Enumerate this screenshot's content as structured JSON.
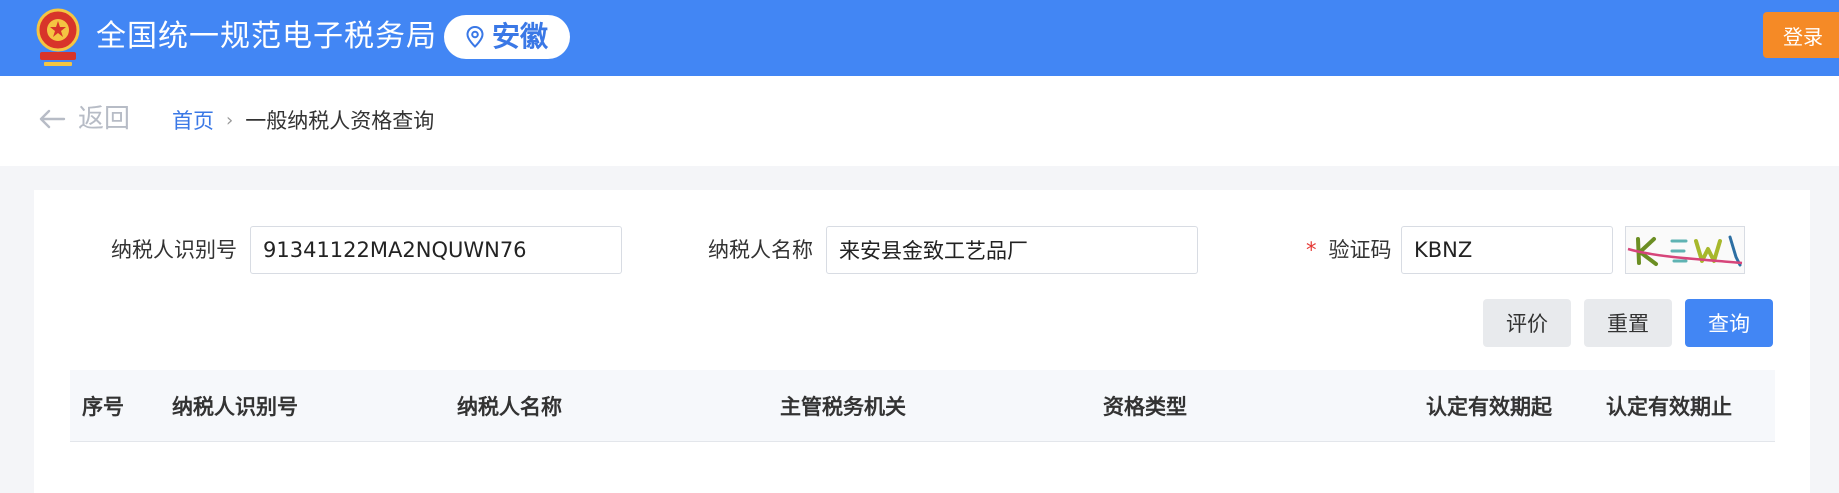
{
  "header": {
    "site_title": "全国统一规范电子税务局",
    "region": "安徽",
    "login_label": "登录",
    "colors": {
      "header_bg": "#4286f4",
      "login_bg": "#f58a26"
    }
  },
  "breadcrumb": {
    "back_label": "返回",
    "home_label": "首页",
    "separator": "›",
    "current_label": "一般纳税人资格查询"
  },
  "form": {
    "taxpayer_id": {
      "label": "纳税人识别号",
      "value": "91341122MA2NQUWN76"
    },
    "taxpayer_name": {
      "label": "纳税人名称",
      "value": "来安县金致工艺品厂"
    },
    "captcha": {
      "required_mark": "*",
      "label": "验证码",
      "value": "KBNZ"
    }
  },
  "actions": {
    "evaluate_label": "评价",
    "reset_label": "重置",
    "query_label": "查询"
  },
  "table": {
    "columns": [
      "序号",
      "纳税人识别号",
      "纳税人名称",
      "主管税务机关",
      "资格类型",
      "认定有效期起",
      "认定有效期止"
    ]
  }
}
